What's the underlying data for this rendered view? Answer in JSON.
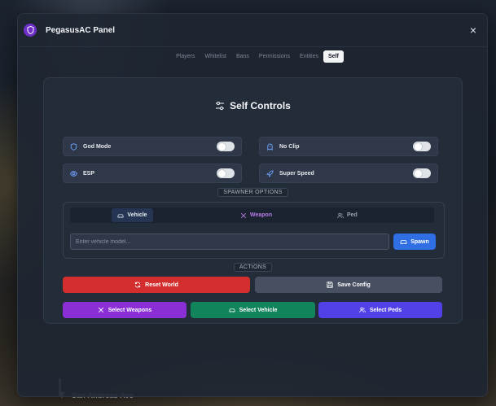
{
  "panel": {
    "title": "PegasusAC Panel",
    "close_label": "×"
  },
  "tabs": [
    {
      "label": "Players",
      "active": false
    },
    {
      "label": "Whitelist",
      "active": false
    },
    {
      "label": "Bans",
      "active": false
    },
    {
      "label": "Permissions",
      "active": false
    },
    {
      "label": "Entities",
      "active": false
    },
    {
      "label": "Self",
      "active": true
    }
  ],
  "self_controls": {
    "title": "Self Controls",
    "toggles": [
      {
        "label": "God Mode",
        "icon": "shield-icon",
        "enabled": false
      },
      {
        "label": "No Clip",
        "icon": "ghost-icon",
        "enabled": false
      },
      {
        "label": "ESP",
        "icon": "eye-icon",
        "enabled": false
      },
      {
        "label": "Super Speed",
        "icon": "rocket-icon",
        "enabled": false
      }
    ]
  },
  "spawner": {
    "section_label": "SPAWNER OPTIONS",
    "tabs": [
      {
        "label": "Vehicle",
        "active": true
      },
      {
        "label": "Weapon",
        "active": false
      },
      {
        "label": "Ped",
        "active": false
      }
    ],
    "input_placeholder": "Enter vehicle model...",
    "input_value": "",
    "spawn_label": "Spawn"
  },
  "actions": {
    "section_label": "ACTIONS",
    "reset_world": "Reset World",
    "save_config": "Save Config",
    "select_weapons": "Select Weapons",
    "select_vehicle": "Select Vehicle",
    "select_peds": "Select Peds"
  },
  "hud": {
    "street": "San Andreas Ave"
  },
  "colors": {
    "accent_blue": "#2f6ee3",
    "danger_red": "#d42d2d",
    "purple": "#8a2fd6",
    "green": "#12845c",
    "indigo": "#5042e6",
    "logo_purple": "#6d2fc6"
  }
}
